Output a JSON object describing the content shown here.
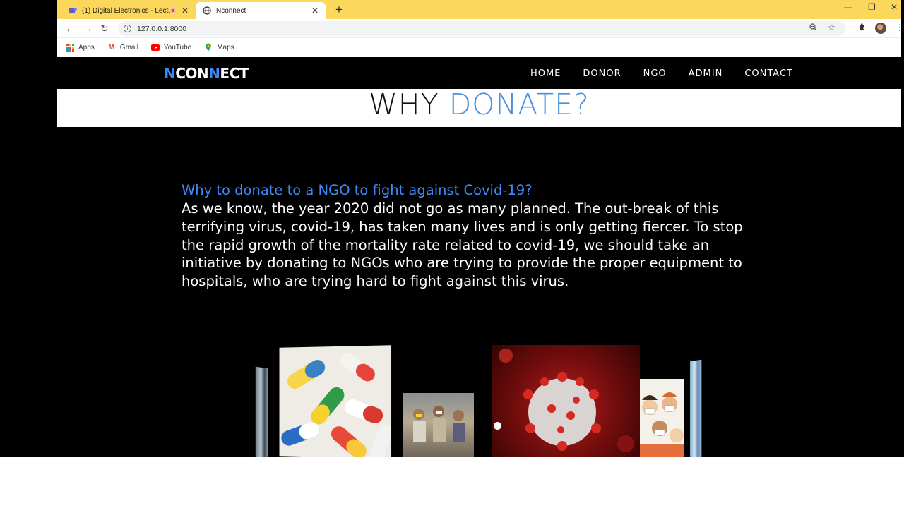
{
  "browser": {
    "tabs": [
      {
        "title": "(1) Digital Electronics - Lectu"
      },
      {
        "title": "Nconnect"
      }
    ],
    "url": "127.0.0.1:8000",
    "bookmarks": [
      {
        "label": "Apps"
      },
      {
        "label": "Gmail"
      },
      {
        "label": "YouTube"
      },
      {
        "label": "Maps"
      }
    ]
  },
  "site": {
    "logo": {
      "n1": "N",
      "con": "CON",
      "n2": "N",
      "ect": "ECT"
    },
    "nav": [
      "HOME",
      "DONOR",
      "NGO",
      "ADMIN",
      "CONTACT"
    ],
    "section_title": {
      "part1": "WHY",
      "part2": "DONATE?"
    },
    "question": "Why to donate to a NGO to fight against Covid-19?",
    "paragraph": "As we know, the year 2020 did not go as many planned. The out-break of this terrifying virus, covid-19, has taken many lives and is only getting fiercer. To stop the rapid growth of the mortality rate related to covid-19, we should take an initiative by donating to NGOs who are trying to provide the proper equipment to hospitals, who are trying hard to fight against this virus."
  },
  "colors": {
    "tabstrip": "#fbd75b",
    "accent_blue": "#3d8af7",
    "heading_blue": "#4a8fe0",
    "navbar": "#000000"
  }
}
